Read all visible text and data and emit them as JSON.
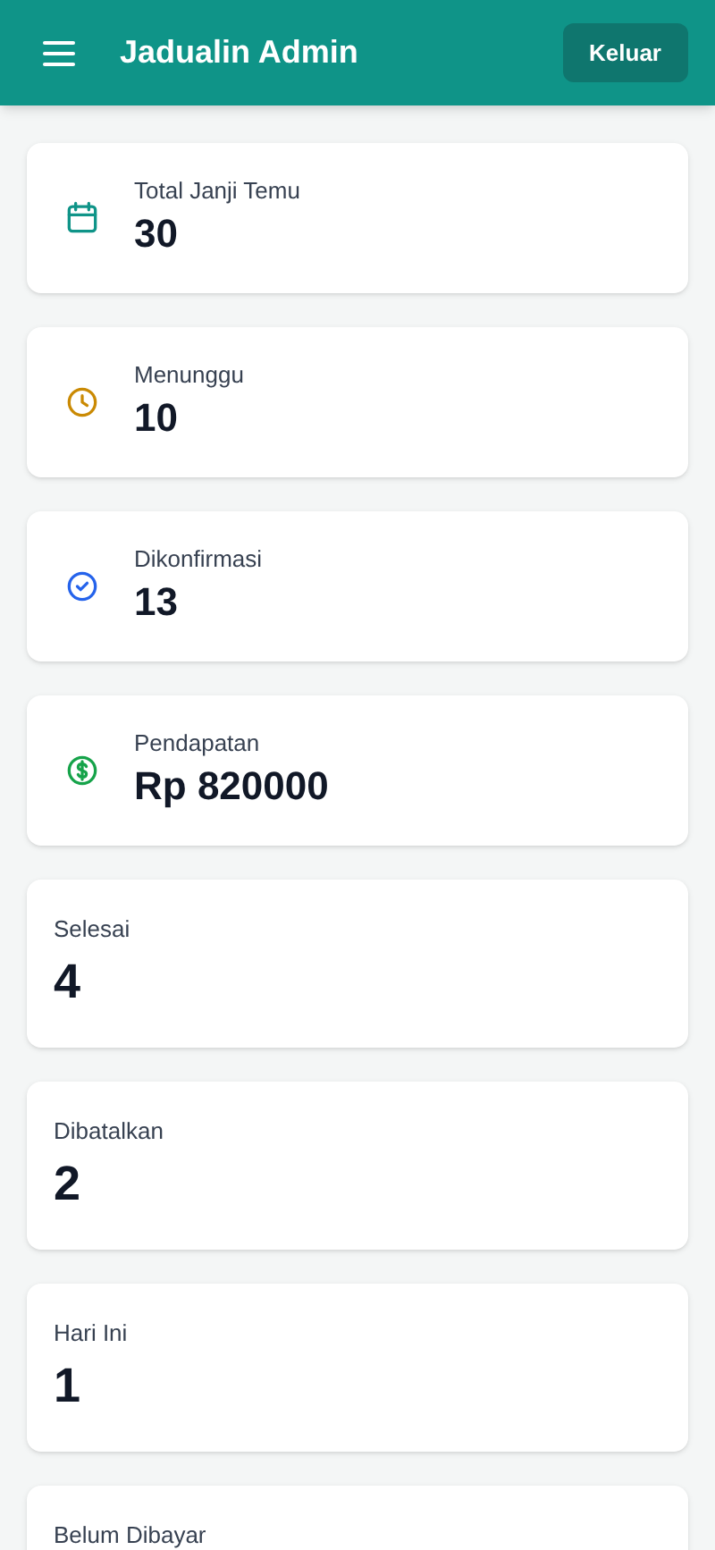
{
  "header": {
    "title": "Jadualin Admin",
    "logout_button": "Keluar"
  },
  "stats": [
    {
      "kind": "calendar",
      "label": "Total Janji Temu",
      "value": "30"
    },
    {
      "kind": "clock",
      "label": "Menunggu",
      "value": "10"
    },
    {
      "kind": "check",
      "label": "Dikonfirmasi",
      "value": "13"
    },
    {
      "kind": "money",
      "label": "Pendapatan",
      "value": "Rp 820000"
    },
    {
      "kind": "plain",
      "label": "Selesai",
      "value": "4"
    },
    {
      "kind": "plain",
      "label": "Dibatalkan",
      "value": "2"
    },
    {
      "kind": "plain",
      "label": "Hari Ini",
      "value": "1"
    },
    {
      "kind": "plain",
      "label": "Belum Dibayar"
    }
  ]
}
